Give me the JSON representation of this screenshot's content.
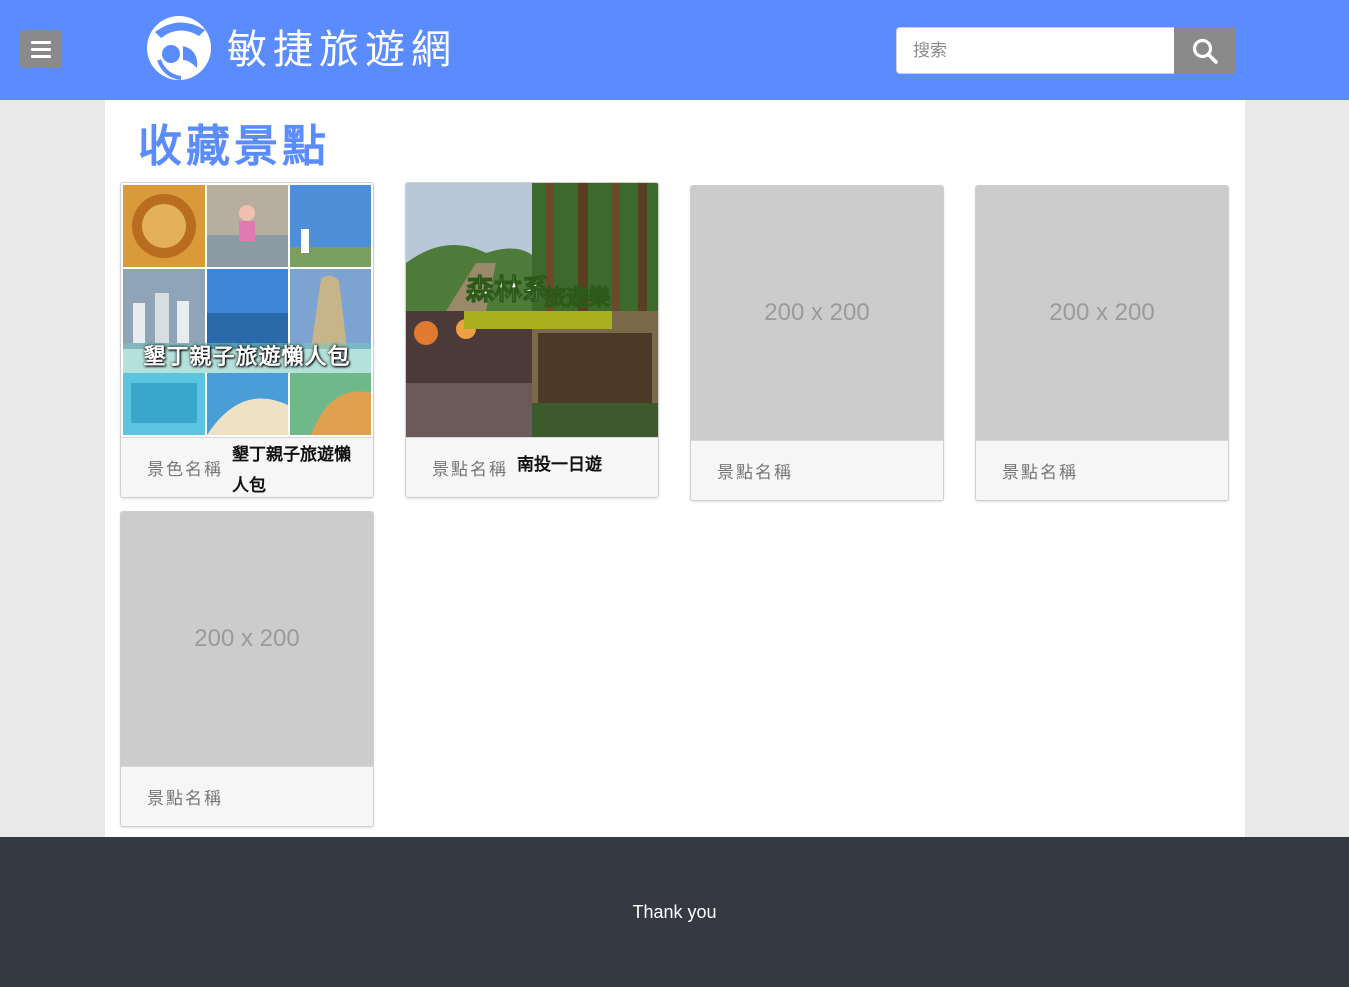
{
  "header": {
    "logo_text": "敏捷旅遊網",
    "search": {
      "placeholder": "搜索",
      "value": ""
    }
  },
  "page": {
    "title": "收藏景點"
  },
  "cards": [
    {
      "name_label": "景色名稱",
      "name_value": "墾丁親子旅遊懶人包",
      "image_caption": "墾丁親子旅遊懶人包",
      "placeholder": ""
    },
    {
      "name_label": "景點名稱",
      "name_value": "南投一日遊",
      "image_caption": "森林系 旅遊樂",
      "placeholder": ""
    },
    {
      "name_label": "景點名稱",
      "name_value": "",
      "placeholder": "200 x 200"
    },
    {
      "name_label": "景點名稱",
      "name_value": "",
      "placeholder": "200 x 200"
    },
    {
      "name_label": "景點名稱",
      "name_value": "",
      "placeholder": "200 x 200"
    }
  ],
  "footer": {
    "text": "Thank you"
  },
  "colors": {
    "header_bg": "#5b8cff",
    "title_color": "#5b8cff",
    "footer_bg": "#353a42",
    "button_gray": "#8a8a8a"
  },
  "icons": {
    "menu": "hamburger-icon",
    "search": "magnifier-icon",
    "logo": "logo-mark-icon"
  }
}
